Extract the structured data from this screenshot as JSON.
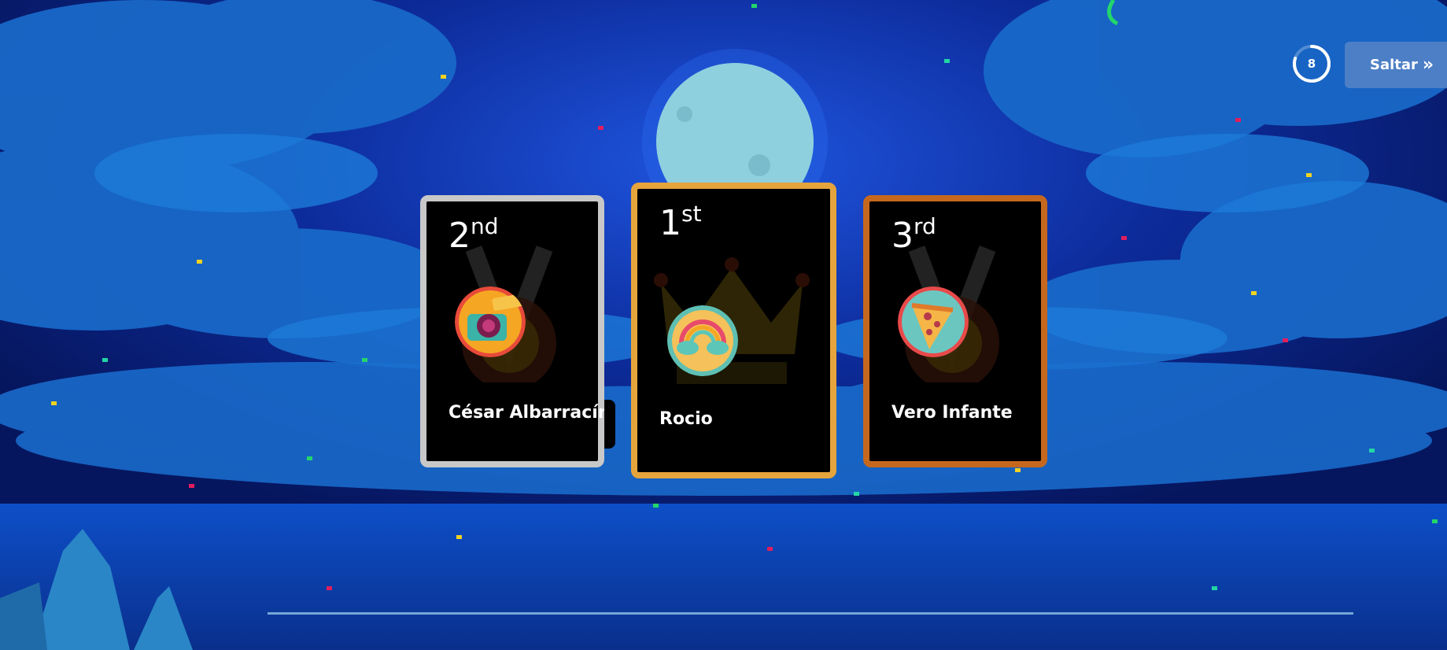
{
  "timer": {
    "value": "8",
    "progress": 0.8
  },
  "skip_button": {
    "label": "Saltar",
    "icon": "double-chevron-right-icon"
  },
  "podium": [
    {
      "place": "2",
      "suffix": "nd",
      "name": "César Albarracín",
      "avatar": "camera-sticker-icon",
      "border": "#c8c8c8"
    },
    {
      "place": "1",
      "suffix": "st",
      "name": "Rocio",
      "avatar": "rainbow-cloud-sticker-icon",
      "border": "#e6a43c"
    },
    {
      "place": "3",
      "suffix": "rd",
      "name": "Vero Infante",
      "avatar": "pizza-slice-sticker-icon",
      "border": "#c5681e"
    }
  ],
  "colors": {
    "sky": "#0a1f7a",
    "cloud": "#1868c8",
    "moon": "#8fd0df",
    "accent": "#ffffff"
  }
}
